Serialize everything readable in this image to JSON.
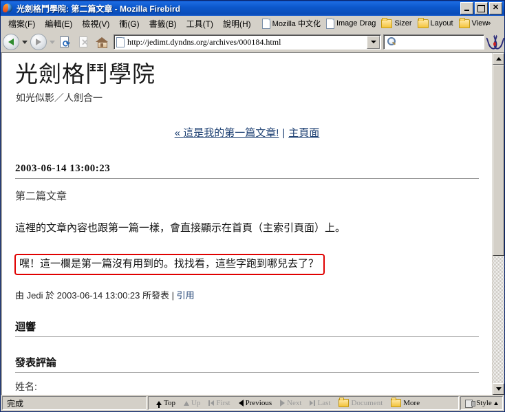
{
  "window": {
    "title": "光劍格鬥學院: 第二篇文章 - Mozilla Firebird",
    "icon": "firebird-icon",
    "minimize": "_",
    "maximize": "□",
    "close": "✕"
  },
  "menubar": {
    "items": [
      {
        "label": "檔案(F)"
      },
      {
        "label": "編輯(E)"
      },
      {
        "label": "檢視(V)"
      },
      {
        "label": "衝(G)"
      },
      {
        "label": "書籤(B)"
      },
      {
        "label": "工具(T)"
      },
      {
        "label": "說明(H)"
      }
    ],
    "bookmarks": [
      {
        "label": "Mozilla 中文化",
        "icon": "document-icon"
      },
      {
        "label": "Image Drag",
        "icon": "document-icon"
      },
      {
        "label": "Sizer",
        "icon": "folder-icon"
      },
      {
        "label": "Layout",
        "icon": "folder-icon"
      },
      {
        "label": "View",
        "icon": "folder-icon",
        "overflow": "»"
      }
    ]
  },
  "toolbar": {
    "back": "back-icon",
    "forward": "forward-icon",
    "reload": "reload-icon",
    "stop": "stop-icon",
    "home": "home-icon",
    "url": "http://jedimt.dyndns.org/archives/000184.html",
    "url_placeholder": "",
    "search_value": "",
    "search_placeholder": "",
    "throbber": "throbber-icon"
  },
  "page": {
    "site_title": "光劍格鬥學院",
    "site_tagline": "如光似影／人劍合一",
    "nav": {
      "prev_marker": "«",
      "prev_label": "這是我的第一篇文章!",
      "separator": "|",
      "home_label": "主頁面"
    },
    "post": {
      "date_heading": "2003-06-14 13:00:23",
      "title": "第二篇文章",
      "body": "這裡的文章內容也跟第一篇一樣，會直接顯示在首頁（主索引頁面）上。",
      "highlight": "嘿！這一欄是第一篇沒有用到的。找找看，這些字跑到哪兒去了？",
      "byline_prefix": "由 Jedi 於 2003-06-14 13:00:23 所發表",
      "byline_sep": "|",
      "byline_link": "引用"
    },
    "sections": {
      "trackbacks": "迴響",
      "comments": "發表評論",
      "name_label": "姓名:",
      "name_value": ""
    },
    "highlight_color": "#e00000",
    "link_color": "#1c3f72"
  },
  "statusbar": {
    "status": "完成",
    "nav": [
      {
        "label": "Top",
        "icon": "arrow-top-icon",
        "enabled": true
      },
      {
        "label": "Up",
        "icon": "arrow-up-icon",
        "enabled": false
      },
      {
        "label": "First",
        "icon": "first-icon",
        "enabled": false
      },
      {
        "label": "Previous",
        "icon": "previous-icon",
        "enabled": true
      },
      {
        "label": "Next",
        "icon": "next-icon",
        "enabled": false
      },
      {
        "label": "Last",
        "icon": "last-icon",
        "enabled": false
      },
      {
        "label": "Document",
        "icon": "folder-icon",
        "enabled": false
      },
      {
        "label": "More",
        "icon": "folder-icon",
        "enabled": true
      }
    ],
    "style_label": "Style",
    "style_icon": "style-icon"
  }
}
